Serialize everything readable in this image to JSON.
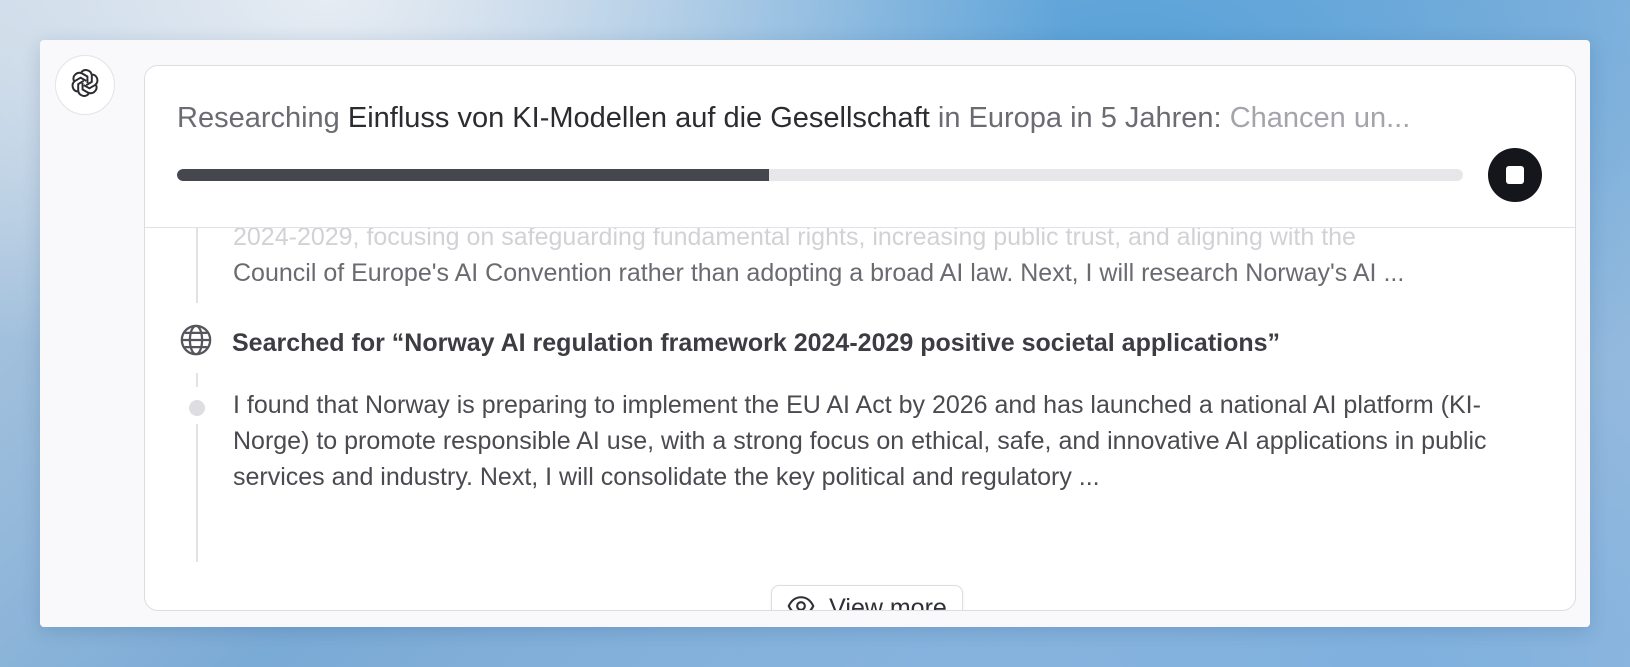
{
  "icons": {
    "assistant": "openai-logo-icon",
    "stop": "stop-icon",
    "search": "globe-icon",
    "view_more": "eye-icon"
  },
  "header": {
    "title_prefix": "Researching",
    "title_topic": "Einfluss von KI-Modellen auf die Gesellschaft",
    "title_mid": "in Europa in 5 Jahren:",
    "title_fade": "Chancen un...",
    "progress_percent": 46
  },
  "activity": {
    "entry1_line1": "2024-2029, focusing on safeguarding fundamental rights, increasing public trust, and aligning with the",
    "entry1_line2": "Council of Europe's AI Convention rather than adopting a broad AI law. Next, I will research Norway's AI ...",
    "search_query": "Searched for “Norway AI regulation framework 2024-2029 positive societal applications”",
    "entry2_text": "I found that Norway is preparing to implement the EU AI Act by 2026 and has launched a national AI platform (KI-Norge) to promote responsible AI use, with a strong focus on ethical, safe, and innovative AI applications in public services and industry. Next, I will consolidate the key political and regulatory ..."
  },
  "view_more_label": "View more",
  "colors": {
    "progress_fill": "#46464f",
    "progress_track": "#e7e7ea",
    "stop_button": "#15161c"
  }
}
